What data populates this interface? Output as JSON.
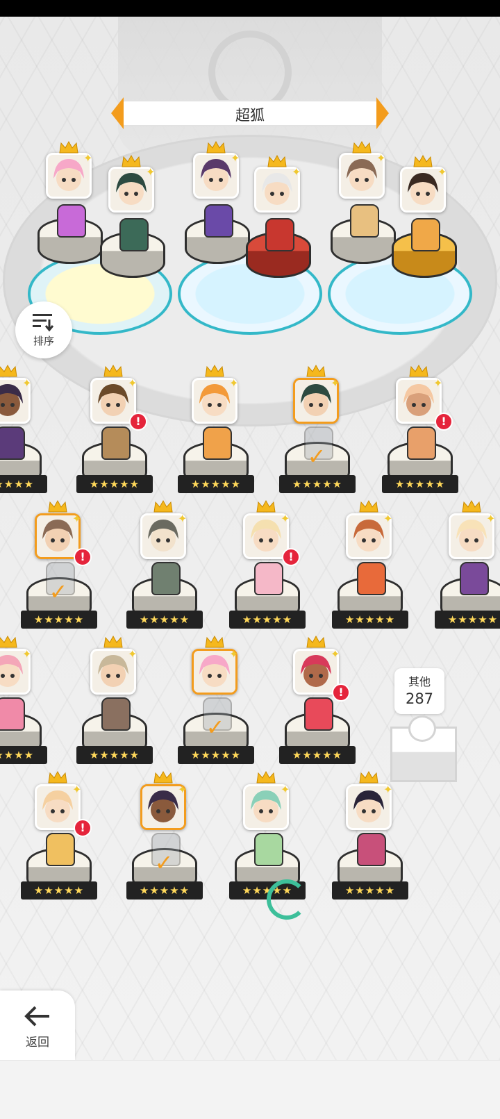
{
  "screen": {
    "banner_title": "超狐",
    "sort_label": "排序",
    "others_label": "其他",
    "others_count": "287",
    "back_label": "返回",
    "stars_text": "★★★★★"
  },
  "colors": {
    "accent": "#f39c1d",
    "alert": "#e5243b",
    "star": "#ffd85a",
    "pad_border": "#33b8c8"
  },
  "team_units": [
    {
      "hair": "#f7a8c8",
      "sprite": "#c86ad8"
    },
    {
      "hair": "#2d4a40",
      "sprite": "#3c6a58"
    },
    {
      "hair": "#5a3a6a",
      "sprite": "#6a4aa8"
    },
    {
      "hair": "#e8e8e8",
      "sprite": "#c8372f"
    },
    {
      "hair": "#8a6a55",
      "sprite": "#e8c080"
    },
    {
      "hair": "#3a2a22",
      "sprite": "#f0a848"
    }
  ],
  "roster": [
    {
      "hair": "#3a2c48",
      "skin": "#8a5a3c",
      "sprite": "#5b3b7a",
      "selected": false,
      "alert": false,
      "placed": false
    },
    {
      "hair": "#6b4a2a",
      "skin": "#f2d1b3",
      "sprite": "#b58c5a",
      "selected": false,
      "alert": true,
      "placed": false
    },
    {
      "hair": "#f39a3a",
      "skin": "#f7dcc3",
      "sprite": "#f0a24a",
      "selected": false,
      "alert": false,
      "placed": false
    },
    {
      "hair": "#2d4a40",
      "skin": "#f2d1b3",
      "sprite": "#9aa0a6",
      "selected": true,
      "alert": false,
      "placed": true
    },
    {
      "hair": "#f5c8a2",
      "skin": "#d9a07a",
      "sprite": "#e8a06a",
      "selected": false,
      "alert": true,
      "placed": false
    },
    {
      "hair": "#8a6a55",
      "skin": "#f2d1b3",
      "sprite": "#9aa0a6",
      "selected": true,
      "alert": true,
      "placed": true
    },
    {
      "hair": "#6a6a60",
      "skin": "#f2e2cc",
      "sprite": "#708070",
      "selected": false,
      "alert": false,
      "placed": false
    },
    {
      "hair": "#f5e0b0",
      "skin": "#f7dcc3",
      "sprite": "#f5b8c8",
      "selected": false,
      "alert": true,
      "placed": false
    },
    {
      "hair": "#c86a3a",
      "skin": "#f7dcc3",
      "sprite": "#e86a3a",
      "selected": false,
      "alert": false,
      "placed": false
    },
    {
      "hair": "#f8e2b8",
      "skin": "#f7dcc3",
      "sprite": "#7a4a9a",
      "selected": false,
      "alert": false,
      "placed": false
    },
    {
      "hair": "#f4a6b8",
      "skin": "#f7dcc3",
      "sprite": "#f08aa8",
      "selected": false,
      "alert": false,
      "placed": false
    },
    {
      "hair": "#c8b89a",
      "skin": "#f2d1b3",
      "sprite": "#8a7060",
      "selected": false,
      "alert": false,
      "placed": false
    },
    {
      "hair": "#f7a8c8",
      "skin": "#f7dcc3",
      "sprite": "#9aa0a6",
      "selected": true,
      "alert": false,
      "placed": true
    },
    {
      "hair": "#d83a5a",
      "skin": "#b06a4a",
      "sprite": "#e84a5a",
      "selected": false,
      "alert": true,
      "placed": false
    },
    {
      "hair": "#f5d0a0",
      "skin": "#f7dcc3",
      "sprite": "#f0c060",
      "selected": false,
      "alert": true,
      "placed": false
    },
    {
      "hair": "#3a2c48",
      "skin": "#8a5a3c",
      "sprite": "#9aa0a6",
      "selected": true,
      "alert": false,
      "placed": true
    },
    {
      "hair": "#8ad0b8",
      "skin": "#f7dcc3",
      "sprite": "#a8d8a0",
      "selected": false,
      "alert": false,
      "placed": false
    },
    {
      "hair": "#2a2438",
      "skin": "#f7dcc3",
      "sprite": "#c8507a",
      "selected": false,
      "alert": false,
      "placed": false
    }
  ]
}
